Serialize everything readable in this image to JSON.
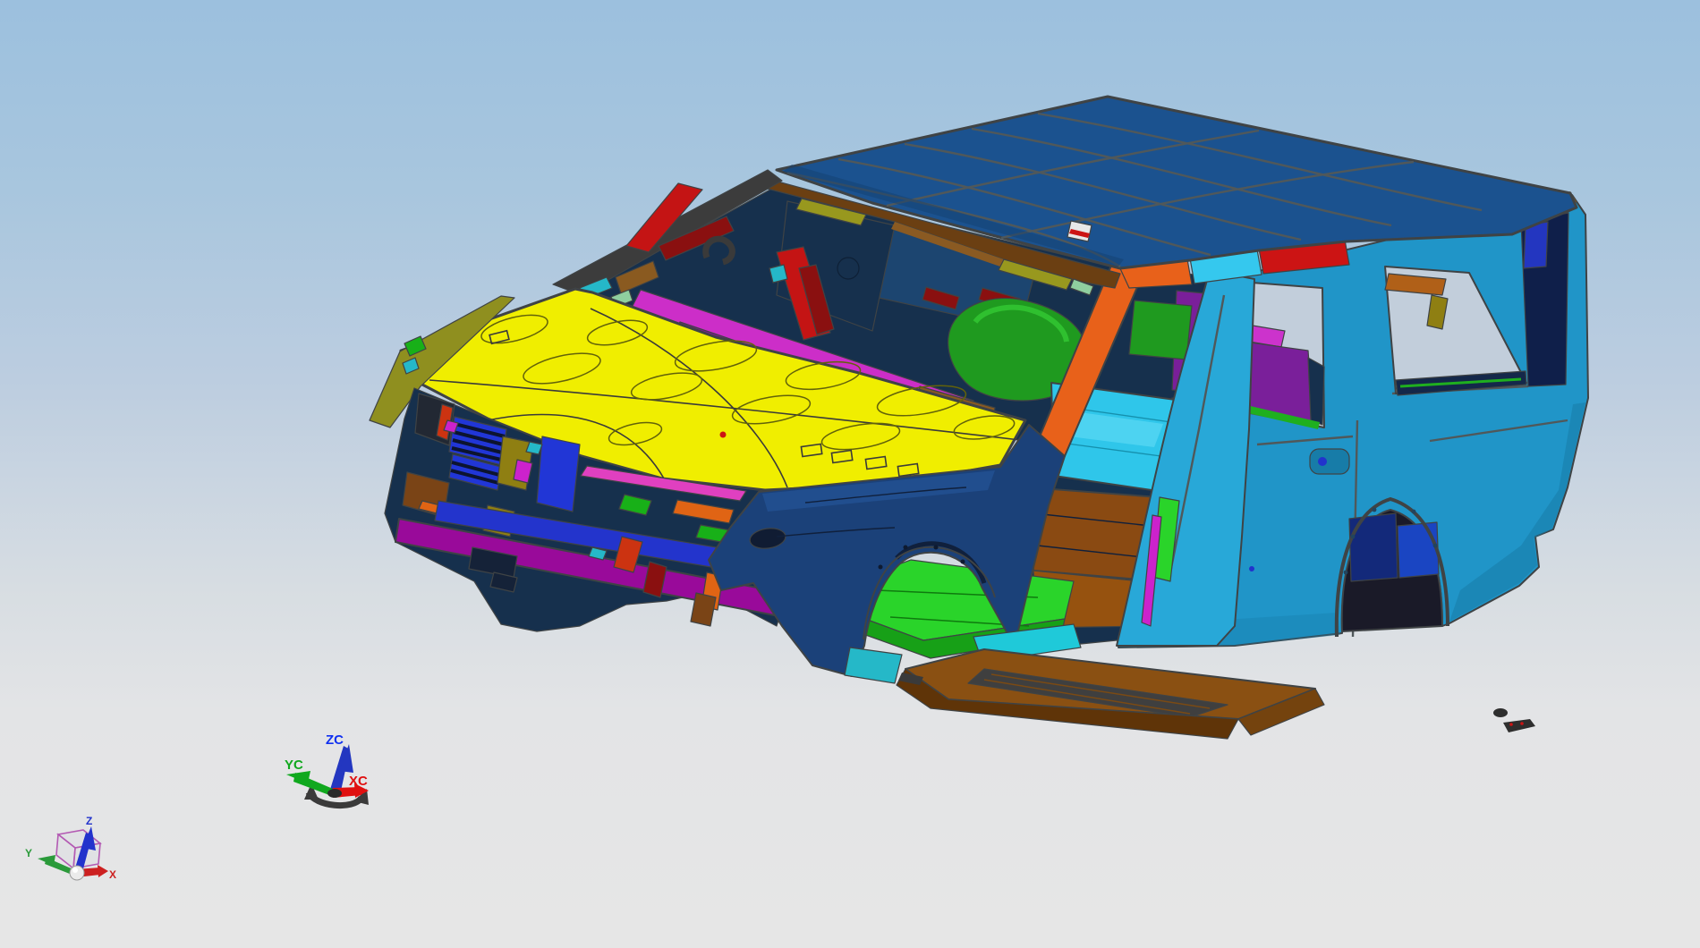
{
  "scene": {
    "description": "3D CAD viewport showing a multi-colored SUV body-in-white sheet-metal assembly, viewed from front-left above",
    "view": "isometric-front-left"
  },
  "background": {
    "sky_top": "#9cc0de",
    "ground_bottom": "#e6e6e6"
  },
  "wcs_triad": {
    "x_label": "XC",
    "y_label": "YC",
    "z_label": "ZC",
    "x_color": "#e01010",
    "y_color": "#10a81e",
    "z_color": "#1030f0",
    "rotator_color": "#3a3a3a"
  },
  "view_triad": {
    "x_label": "X",
    "y_label": "Y",
    "z_label": "Z",
    "x_color": "#cc2020",
    "y_color": "#2a9a3a",
    "z_color": "#2233cc",
    "cube_color": "#b35ab3",
    "origin_color": "#ebebeb"
  },
  "palette": {
    "roof": "#1b528f",
    "roof_shade": "#143f70",
    "header_brown": "#6b3f12",
    "header_brown_light": "#8a5a22",
    "olive": "#98981e",
    "dark_red": "#8a1010",
    "pale_green": "#8fcf9f",
    "rail_cyan": "#35c8ee",
    "rail_red": "#cc1414",
    "white_part": "#e8e8e8",
    "apillar_orange": "#e8611a",
    "bpillar_blue": "#28a8d8",
    "bodyside": "#2095c8",
    "bodyside_dark": "#177ca8",
    "window_pale": "#c2cedb",
    "cargo_purple": "#7a1f9a",
    "trim_magenta": "#cc33cc",
    "gold": "#b8860b",
    "navy_box": "#13297a",
    "blue_box": "#1a45c2",
    "arch_dark": "#1a1a28",
    "dpillar_navy": "#0f1f4a",
    "dpillar_blue": "#2336c0",
    "orange_bracket": "#b06018",
    "sill_navy": "#14284a",
    "sill_green": "#1faf1f",
    "hood_yellow": "#f0ee00",
    "flange_olive": "#8f8f1f",
    "interior_navy": "#16304d",
    "interior_navy2": "#1c4570",
    "seat_green": "#1f9a1f",
    "seat_green_hi": "#2fc02f",
    "dash_magenta": "#cc2ec8",
    "dash_purple": "#8a129a",
    "red_part": "#c41414",
    "teal": "#25b8c8",
    "fender_navy": "#1b4179",
    "fender_navy_hi": "#214e8e",
    "fender_hole": "#101c33",
    "floor_green": "#2ad42a",
    "floor_green_dark": "#17a017",
    "tunnel_brown": "#8a4a12",
    "floor_brown": "#96520f",
    "floor_cyan": "#2fc6ea",
    "floor_cyan_hi": "#66dff5",
    "rocker_cyan": "#1fc9d9",
    "board_brown": "#8a5012",
    "board_brown_dark": "#5f3408",
    "board_brown_end": "#74430e",
    "board_tread": "#3f3f3f",
    "grille_blue": "#2136d6",
    "grille_slot": "#0c1430",
    "beam_blue": "#2334cc",
    "bumper_purple": "#990a9a",
    "brown_part": "#7a4416",
    "orange_part": "#e06414",
    "green_part": "#18b018",
    "red_orange": "#cc3311",
    "cowl_pink": "#e040c0",
    "cowl_brown": "#8a5a20",
    "hitch_navy": "#152238",
    "dark_olive": "#8f7f12",
    "magenta_part": "#cc22cc",
    "headlight_dark": "#222833",
    "band_gray": "#3c3c3c",
    "debris": "#2e2e2e",
    "plug_blue": "#2233cc"
  }
}
